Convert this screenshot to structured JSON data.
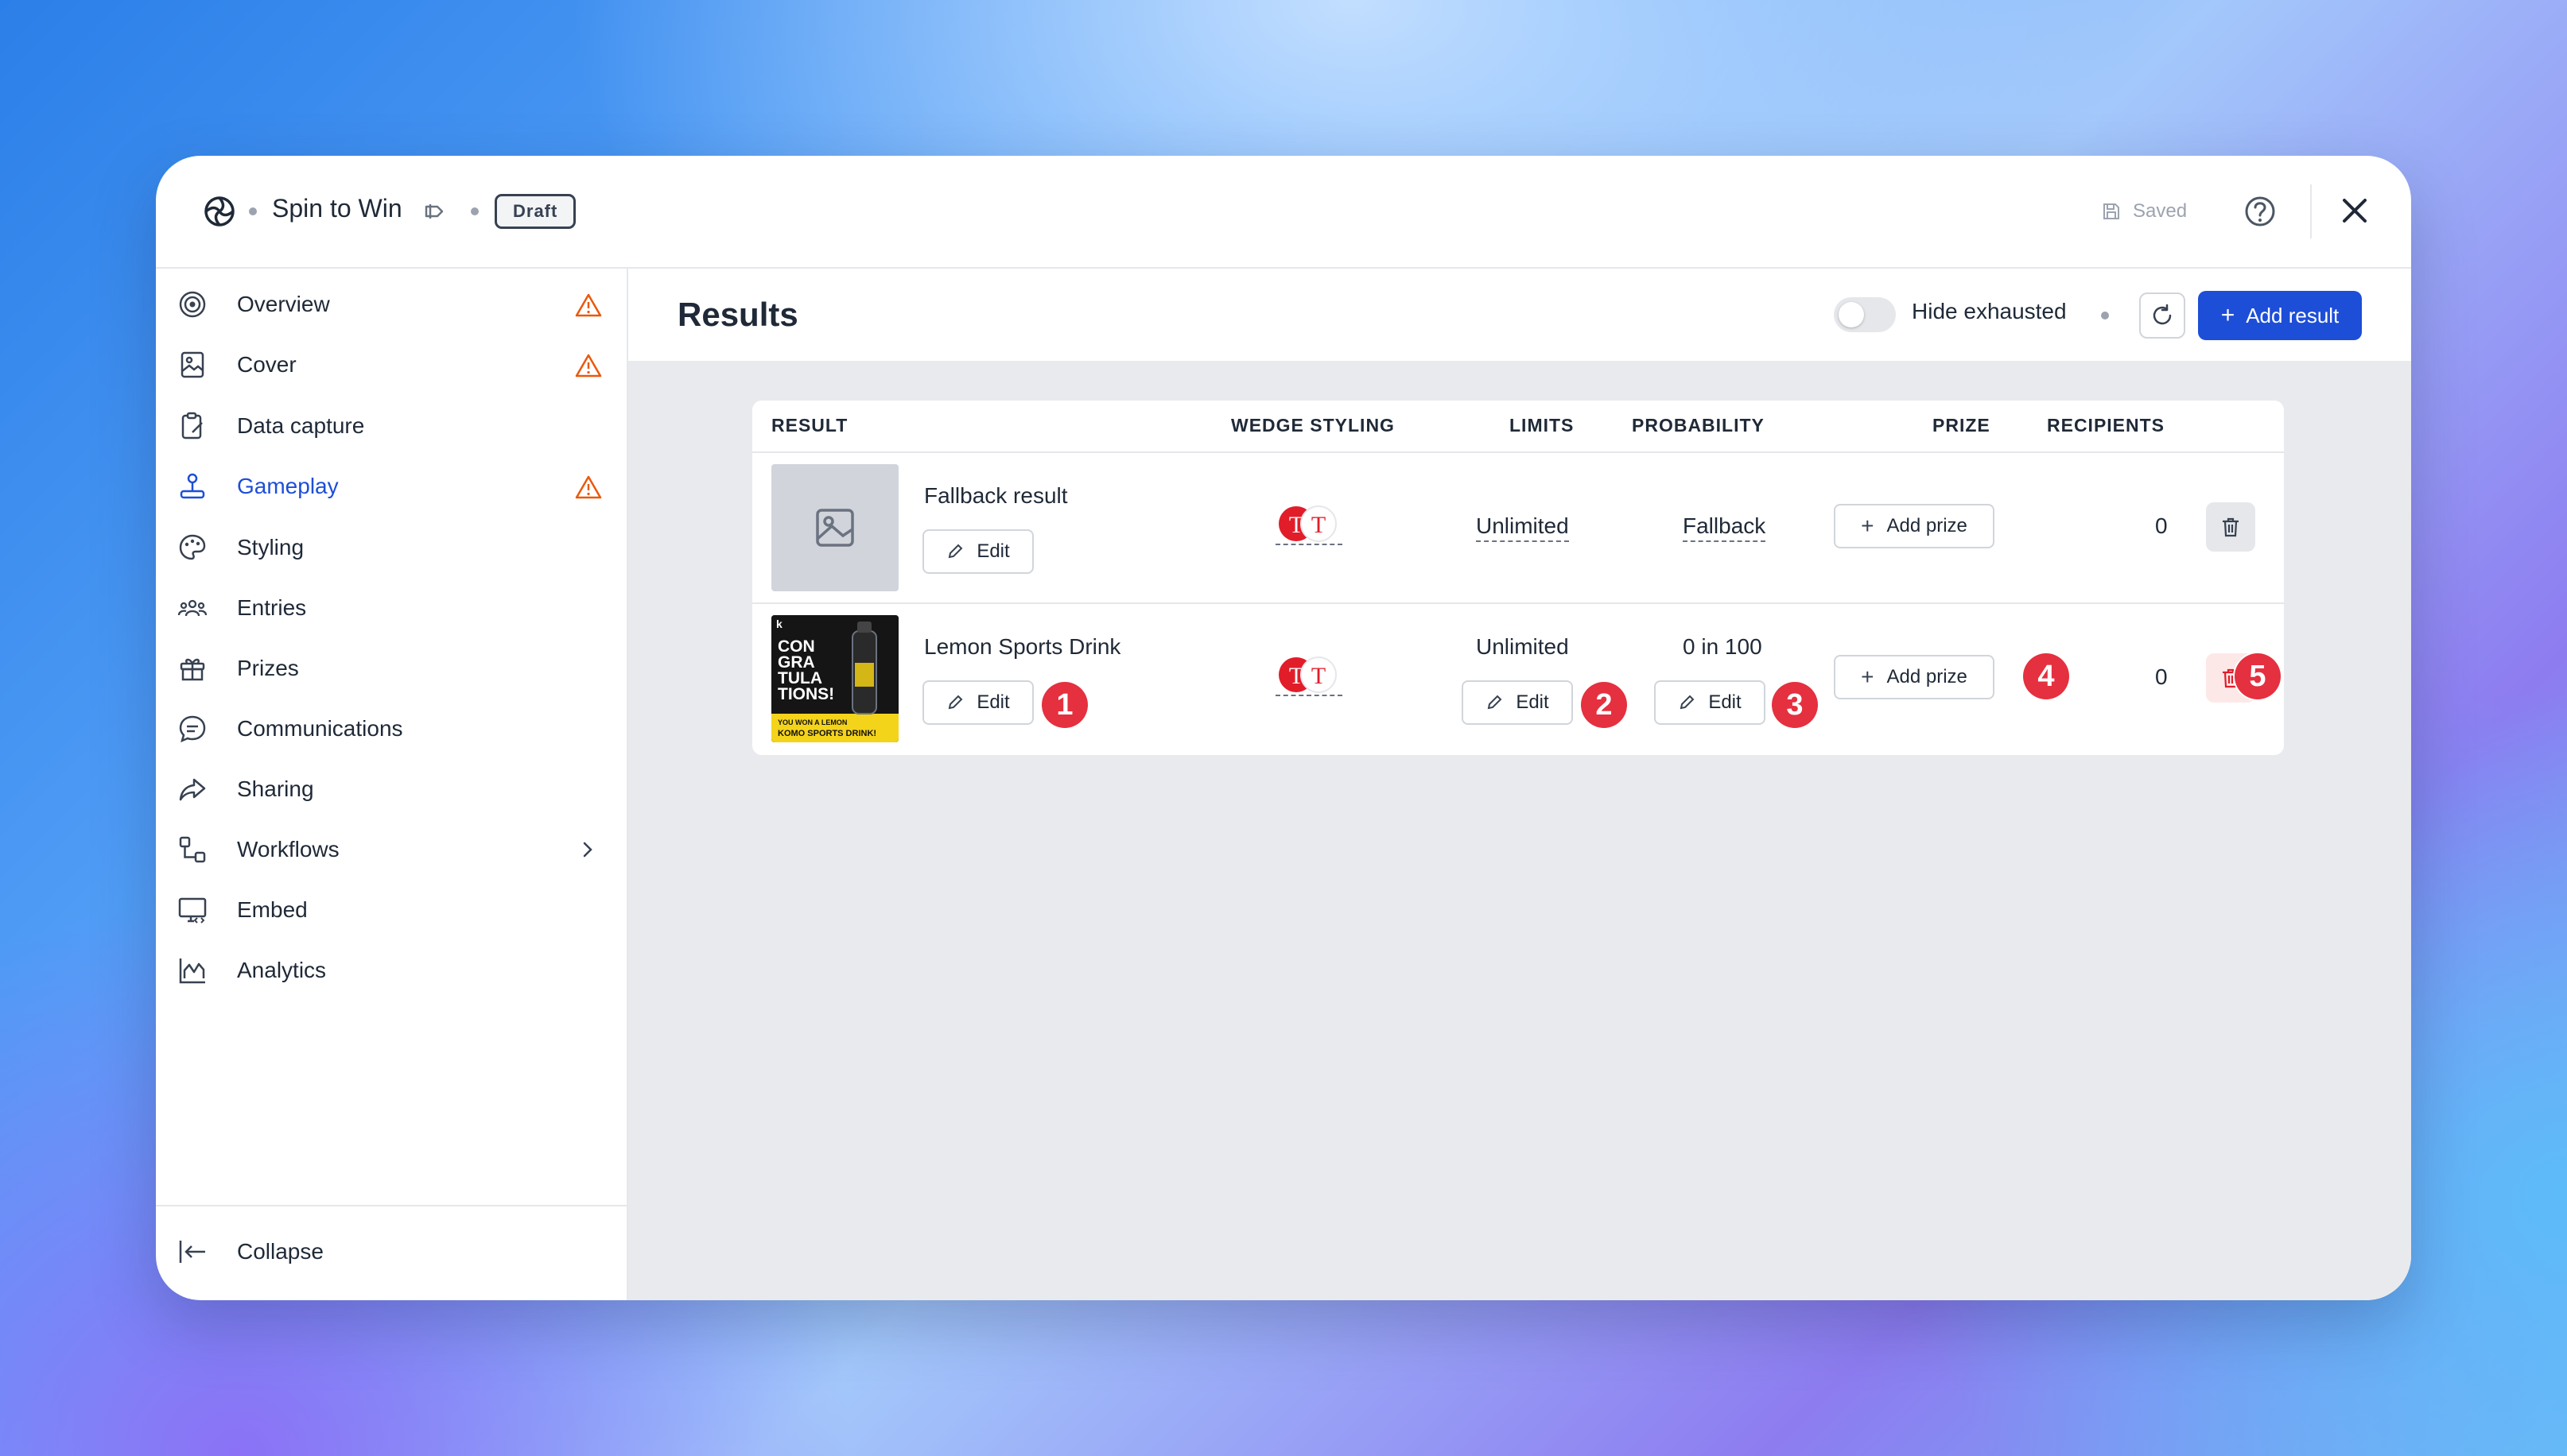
{
  "header": {
    "app_title": "Spin to Win",
    "status_badge": "Draft",
    "saved_label": "Saved",
    "icons": [
      "spiral-logo-icon",
      "tag-icon",
      "save-icon",
      "help-icon",
      "close-icon"
    ]
  },
  "sidebar": {
    "items": [
      {
        "label": "Overview",
        "icon": "target-icon",
        "warning": true
      },
      {
        "label": "Cover",
        "icon": "image-icon",
        "warning": true
      },
      {
        "label": "Data capture",
        "icon": "clipboard-icon",
        "warning": false
      },
      {
        "label": "Gameplay",
        "icon": "joystick-icon",
        "warning": true,
        "active": true
      },
      {
        "label": "Styling",
        "icon": "palette-icon",
        "warning": false
      },
      {
        "label": "Entries",
        "icon": "users-icon",
        "warning": false
      },
      {
        "label": "Prizes",
        "icon": "gift-icon",
        "warning": false
      },
      {
        "label": "Communications",
        "icon": "chat-icon",
        "warning": false
      },
      {
        "label": "Sharing",
        "icon": "share-icon",
        "warning": false
      },
      {
        "label": "Workflows",
        "icon": "workflow-icon",
        "warning": false,
        "chevron": true
      },
      {
        "label": "Embed",
        "icon": "monitor-code-icon",
        "warning": false
      },
      {
        "label": "Analytics",
        "icon": "chart-icon",
        "warning": false
      }
    ],
    "collapse_label": "Collapse"
  },
  "main": {
    "title": "Results",
    "hide_exhausted_label": "Hide exhausted",
    "hide_exhausted_on": false,
    "add_result_label": "Add result"
  },
  "table": {
    "columns": [
      "RESULT",
      "WEDGE STYLING",
      "LIMITS",
      "PROBABILITY",
      "PRIZE",
      "RECIPIENTS"
    ],
    "rows": [
      {
        "name": "Fallback result",
        "edit_label": "Edit",
        "limits": "Unlimited",
        "probability": "Fallback",
        "add_prize_label": "Add prize",
        "recipients": "0"
      },
      {
        "name": "Lemon Sports Drink",
        "edit_label": "Edit",
        "limits": "Unlimited",
        "limits_edit_label": "Edit",
        "probability": "0 in 100",
        "probability_edit_label": "Edit",
        "add_prize_label": "Add prize",
        "recipients": "0",
        "image_text": {
          "line1": "CON",
          "line2": "GRA",
          "line3": "TULA",
          "line4": "TIONS!",
          "sub1": "YOU WON A LEMON",
          "sub2": "KOMO SPORTS DRINK!"
        }
      }
    ]
  },
  "annotations": [
    "1",
    "2",
    "3",
    "4",
    "5"
  ],
  "colors": {
    "accent": "#1d4ed8",
    "warning": "#ea580c",
    "badge": "#e5303f",
    "wedge_red": "#e11d2a"
  }
}
